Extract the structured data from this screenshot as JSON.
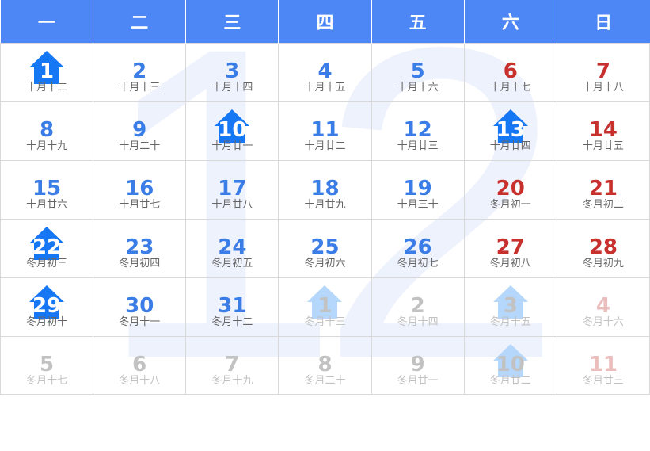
{
  "month_watermark": "12",
  "colors": {
    "header_bg": "#4d86f5",
    "weekday": "#3a7de6",
    "weekend": "#c7302d",
    "house": "#1677f4",
    "house_faded": "#b5d7fb"
  },
  "headers": [
    "一",
    "二",
    "三",
    "四",
    "五",
    "六",
    "日"
  ],
  "weeks": [
    [
      {
        "day": "1",
        "lunar": "十月十二",
        "type": "wd",
        "house": "solid"
      },
      {
        "day": "2",
        "lunar": "十月十三",
        "type": "wd"
      },
      {
        "day": "3",
        "lunar": "十月十四",
        "type": "wd"
      },
      {
        "day": "4",
        "lunar": "十月十五",
        "type": "wd"
      },
      {
        "day": "5",
        "lunar": "十月十六",
        "type": "wd"
      },
      {
        "day": "6",
        "lunar": "十月十七",
        "type": "we"
      },
      {
        "day": "7",
        "lunar": "十月十八",
        "type": "we"
      }
    ],
    [
      {
        "day": "8",
        "lunar": "十月十九",
        "type": "wd"
      },
      {
        "day": "9",
        "lunar": "十月二十",
        "type": "wd"
      },
      {
        "day": "10",
        "lunar": "十月廿一",
        "type": "wd",
        "house": "solid"
      },
      {
        "day": "11",
        "lunar": "十月廿二",
        "type": "wd"
      },
      {
        "day": "12",
        "lunar": "十月廿三",
        "type": "wd"
      },
      {
        "day": "13",
        "lunar": "十月廿四",
        "type": "wd",
        "house": "solid"
      },
      {
        "day": "14",
        "lunar": "十月廿五",
        "type": "we"
      }
    ],
    [
      {
        "day": "15",
        "lunar": "十月廿六",
        "type": "wd"
      },
      {
        "day": "16",
        "lunar": "十月廿七",
        "type": "wd"
      },
      {
        "day": "17",
        "lunar": "十月廿八",
        "type": "wd"
      },
      {
        "day": "18",
        "lunar": "十月廿九",
        "type": "wd"
      },
      {
        "day": "19",
        "lunar": "十月三十",
        "type": "wd"
      },
      {
        "day": "20",
        "lunar": "冬月初一",
        "type": "we"
      },
      {
        "day": "21",
        "lunar": "冬月初二",
        "type": "we"
      }
    ],
    [
      {
        "day": "22",
        "lunar": "冬月初三",
        "type": "wd",
        "house": "solid"
      },
      {
        "day": "23",
        "lunar": "冬月初四",
        "type": "wd"
      },
      {
        "day": "24",
        "lunar": "冬月初五",
        "type": "wd"
      },
      {
        "day": "25",
        "lunar": "冬月初六",
        "type": "wd"
      },
      {
        "day": "26",
        "lunar": "冬月初七",
        "type": "wd"
      },
      {
        "day": "27",
        "lunar": "冬月初八",
        "type": "we"
      },
      {
        "day": "28",
        "lunar": "冬月初九",
        "type": "we"
      }
    ],
    [
      {
        "day": "29",
        "lunar": "冬月初十",
        "type": "wd",
        "house": "solid"
      },
      {
        "day": "30",
        "lunar": "冬月十一",
        "type": "wd"
      },
      {
        "day": "31",
        "lunar": "冬月十二",
        "type": "wd"
      },
      {
        "day": "1",
        "lunar": "冬月十三",
        "type": "wd",
        "other": true,
        "house": "faded"
      },
      {
        "day": "2",
        "lunar": "冬月十四",
        "type": "wd",
        "other": true
      },
      {
        "day": "3",
        "lunar": "冬月十五",
        "type": "wd",
        "other": true,
        "house": "faded"
      },
      {
        "day": "4",
        "lunar": "冬月十六",
        "type": "we",
        "other": true
      }
    ],
    [
      {
        "day": "5",
        "lunar": "冬月十七",
        "type": "wd",
        "other": true
      },
      {
        "day": "6",
        "lunar": "冬月十八",
        "type": "wd",
        "other": true
      },
      {
        "day": "7",
        "lunar": "冬月十九",
        "type": "wd",
        "other": true
      },
      {
        "day": "8",
        "lunar": "冬月二十",
        "type": "wd",
        "other": true
      },
      {
        "day": "9",
        "lunar": "冬月廿一",
        "type": "wd",
        "other": true
      },
      {
        "day": "10",
        "lunar": "冬月廿二",
        "type": "wd",
        "other": true,
        "house": "faded"
      },
      {
        "day": "11",
        "lunar": "冬月廿三",
        "type": "we",
        "other": true
      }
    ]
  ]
}
